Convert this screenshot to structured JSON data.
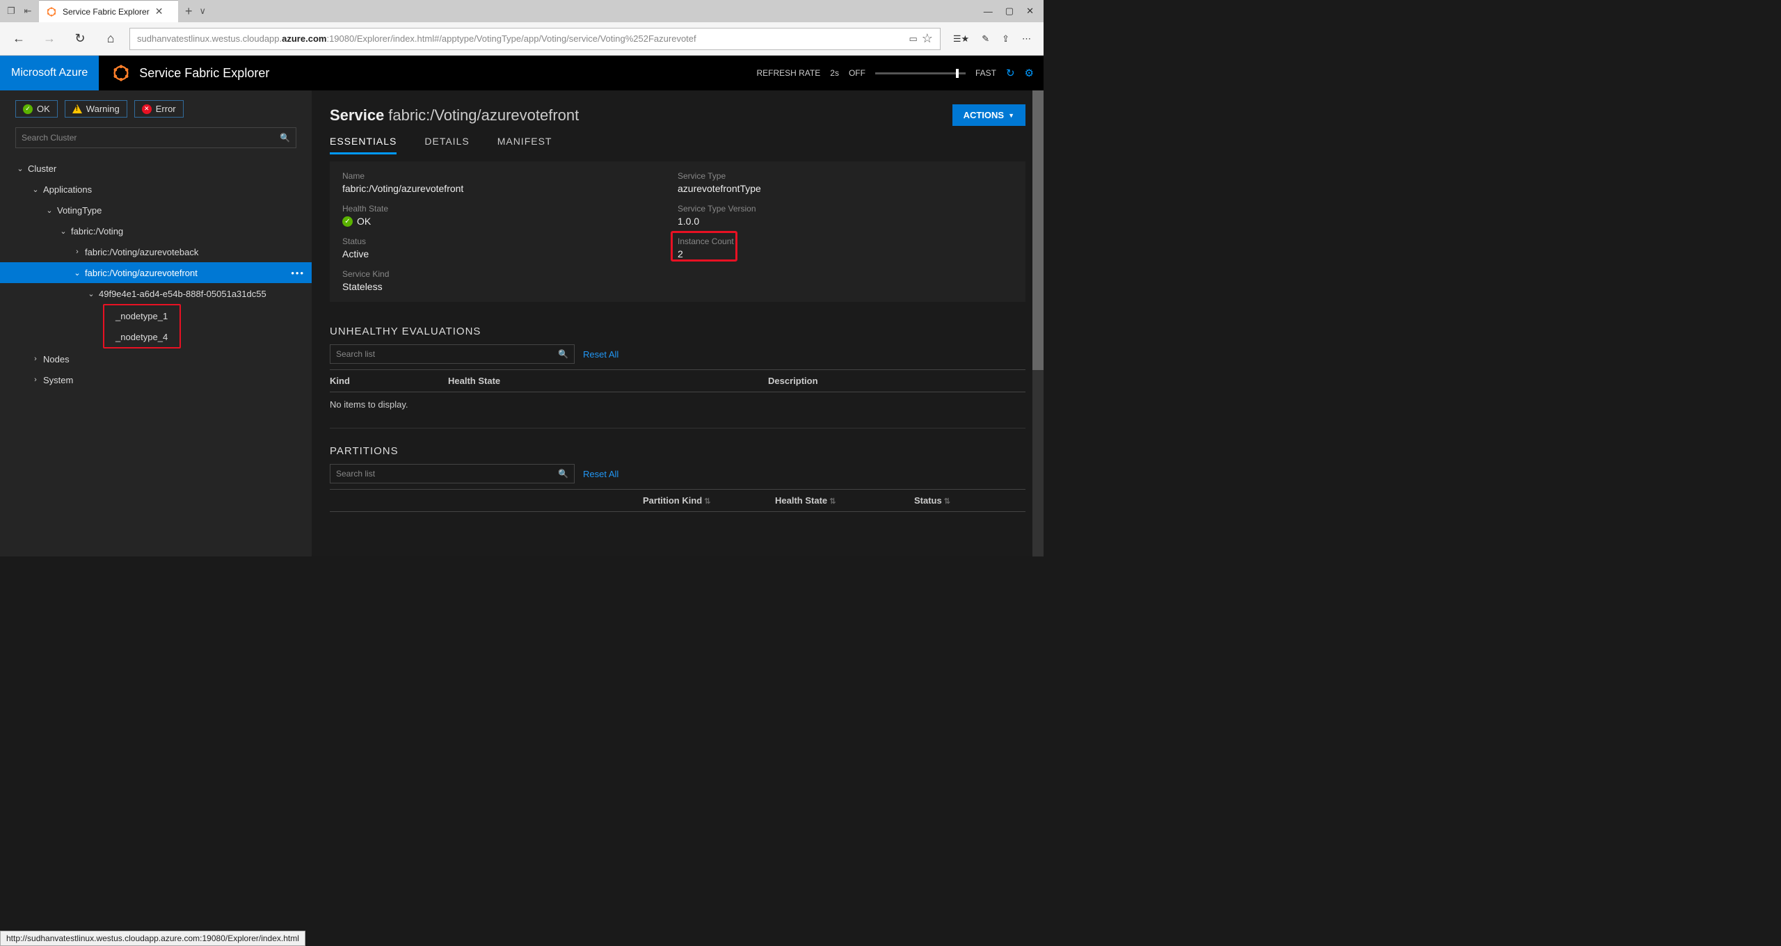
{
  "browser": {
    "tab_title": "Service Fabric Explorer",
    "url_prefix": "sudhanvatestlinux.westus.cloudapp.",
    "url_bold": "azure.com",
    "url_suffix": ":19080/Explorer/index.html#/apptype/VotingType/app/Voting/service/Voting%252Fazurevotef",
    "status_url": "http://sudhanvatestlinux.westus.cloudapp.azure.com:19080/Explorer/index.html"
  },
  "header": {
    "brand": "Microsoft Azure",
    "app_title": "Service Fabric Explorer",
    "refresh_label": "REFRESH RATE",
    "refresh_interval": "2s",
    "off_label": "OFF",
    "fast_label": "FAST"
  },
  "sidebar": {
    "health": {
      "ok": "OK",
      "warning": "Warning",
      "error": "Error"
    },
    "search_placeholder": "Search Cluster",
    "tree": {
      "cluster": "Cluster",
      "applications": "Applications",
      "apptype": "VotingType",
      "app": "fabric:/Voting",
      "svc_back": "fabric:/Voting/azurevoteback",
      "svc_front": "fabric:/Voting/azurevotefront",
      "partition": "49f9e4e1-a6d4-e54b-888f-05051a31dc55",
      "node1": "_nodetype_1",
      "node4": "_nodetype_4",
      "nodes": "Nodes",
      "system": "System"
    }
  },
  "page": {
    "title_prefix": "Service",
    "title_suffix": "fabric:/Voting/azurevotefront",
    "actions_label": "ACTIONS",
    "tabs": {
      "essentials": "ESSENTIALS",
      "details": "DETAILS",
      "manifest": "MANIFEST"
    }
  },
  "essentials": {
    "name_label": "Name",
    "name_value": "fabric:/Voting/azurevotefront",
    "type_label": "Service Type",
    "type_value": "azurevotefrontType",
    "health_label": "Health State",
    "health_value": "OK",
    "version_label": "Service Type Version",
    "version_value": "1.0.0",
    "status_label": "Status",
    "status_value": "Active",
    "instance_label": "Instance Count",
    "instance_value": "2",
    "kind_label": "Service Kind",
    "kind_value": "Stateless"
  },
  "unhealthy": {
    "title": "UNHEALTHY EVALUATIONS",
    "search_placeholder": "Search list",
    "reset": "Reset All",
    "cols": {
      "kind": "Kind",
      "health": "Health State",
      "desc": "Description"
    },
    "empty": "No items to display."
  },
  "partitions": {
    "title": "PARTITIONS",
    "search_placeholder": "Search list",
    "reset": "Reset All",
    "cols": {
      "pkind": "Partition Kind",
      "health": "Health State",
      "status": "Status"
    }
  }
}
